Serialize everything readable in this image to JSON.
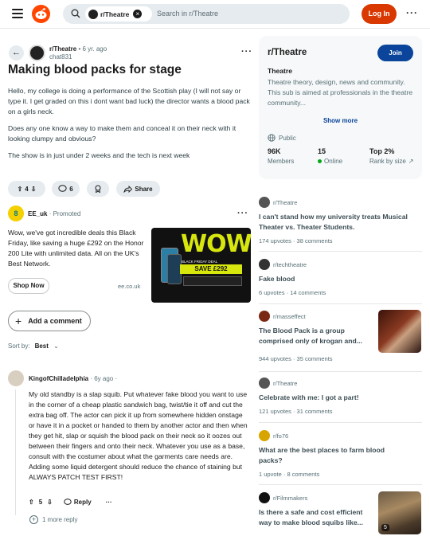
{
  "header": {
    "search_chip": "r/Theatre",
    "search_placeholder": "Search in r/Theatre",
    "login_label": "Log In"
  },
  "post": {
    "subreddit": "r/Theatre",
    "age": "• 6 yr. ago",
    "username": "chat831",
    "title": "Making blood packs for stage",
    "body": [
      "Hello, my college is doing a performance of the Scottish play (I will not say or type it. I get graded on this i dont want bad luck) the director wants a blood pack on a girls neck.",
      "Does any one know a way to make them and conceal it on their neck with it looking clumpy and obvious?",
      "The show is in just under 2 weeks and the tech is next week"
    ],
    "votes": "4",
    "comments": "6",
    "share_label": "Share"
  },
  "ad": {
    "advertiser": "EE_uk",
    "promoted": "· Promoted",
    "text": "Wow, we've got incredible deals this Black Friday, like saving a huge £292 on the Honor 200 Lite with unlimited data. All on the UK's Best Network.",
    "cta": "Shop Now",
    "domain": "ee.co.uk",
    "image_headline": "WOW",
    "image_subline": "BLACK FRIDAY DEAL",
    "image_offer": "SAVE £292"
  },
  "comments_section": {
    "add_comment": "Add a comment",
    "sort_label": "Sort by:",
    "sort_value": "Best"
  },
  "comment": {
    "author": "KingofChilladelphia",
    "age": "· 6y ago ·",
    "body": "My old standby is a slap squib. Put whatever fake blood you want to use in the corner of a cheap plastic sandwich bag, twist/tie it off and cut the extra bag off. The actor can pick it up from somewhere hidden onstage or have it in a pocket or handed to them by another actor and then when they get hit, slap or squish the blood pack on their neck so it oozes out between their fingers and onto their neck. Whatever you use as a base, consult with the costumer about what the garments care needs are. Adding some liquid detergent should reduce the chance of staining but ALWAYS PATCH TEST FIRST!",
    "votes": "5",
    "reply_label": "Reply",
    "more_replies": "1 more reply"
  },
  "community": {
    "title": "r/Theatre",
    "join_label": "Join",
    "name": "Theatre",
    "description": "Theatre theory, design, news and community. This sub is aimed at professionals in the theatre community...",
    "show_more": "Show more",
    "visibility": "Public",
    "members_value": "96K",
    "members_label": "Members",
    "online_value": "15",
    "online_label": "Online",
    "rank_value": "Top 2%",
    "rank_label": "Rank by size"
  },
  "related": [
    {
      "sub": "r/Theatre",
      "title": "I can't stand how my university treats Musical Theater vs. Theater Students.",
      "stats": "174 upvotes · 38 comments"
    },
    {
      "sub": "r/techtheatre",
      "title": "Fake blood",
      "stats": "6 upvotes · 14 comments"
    },
    {
      "sub": "r/masseffect",
      "title": "The Blood Pack is a group comprised only of krogan and...",
      "stats": "944 upvotes · 35 comments"
    },
    {
      "sub": "r/Theatre",
      "title": "Celebrate with me: I got a part!",
      "stats": "121 upvotes · 31 comments"
    },
    {
      "sub": "r/fo76",
      "title": "What are the best places to farm blood packs?",
      "stats": "1 upvote · 8 comments"
    },
    {
      "sub": "r/Filmmakers",
      "title": "Is there a safe and cost efficient way to make blood squibs like...",
      "stats": "",
      "thumb_badge": "5"
    }
  ],
  "colors": {
    "brand": "#ff4500",
    "login": "#d93900",
    "join": "#0a449b",
    "online": "#01a816"
  }
}
